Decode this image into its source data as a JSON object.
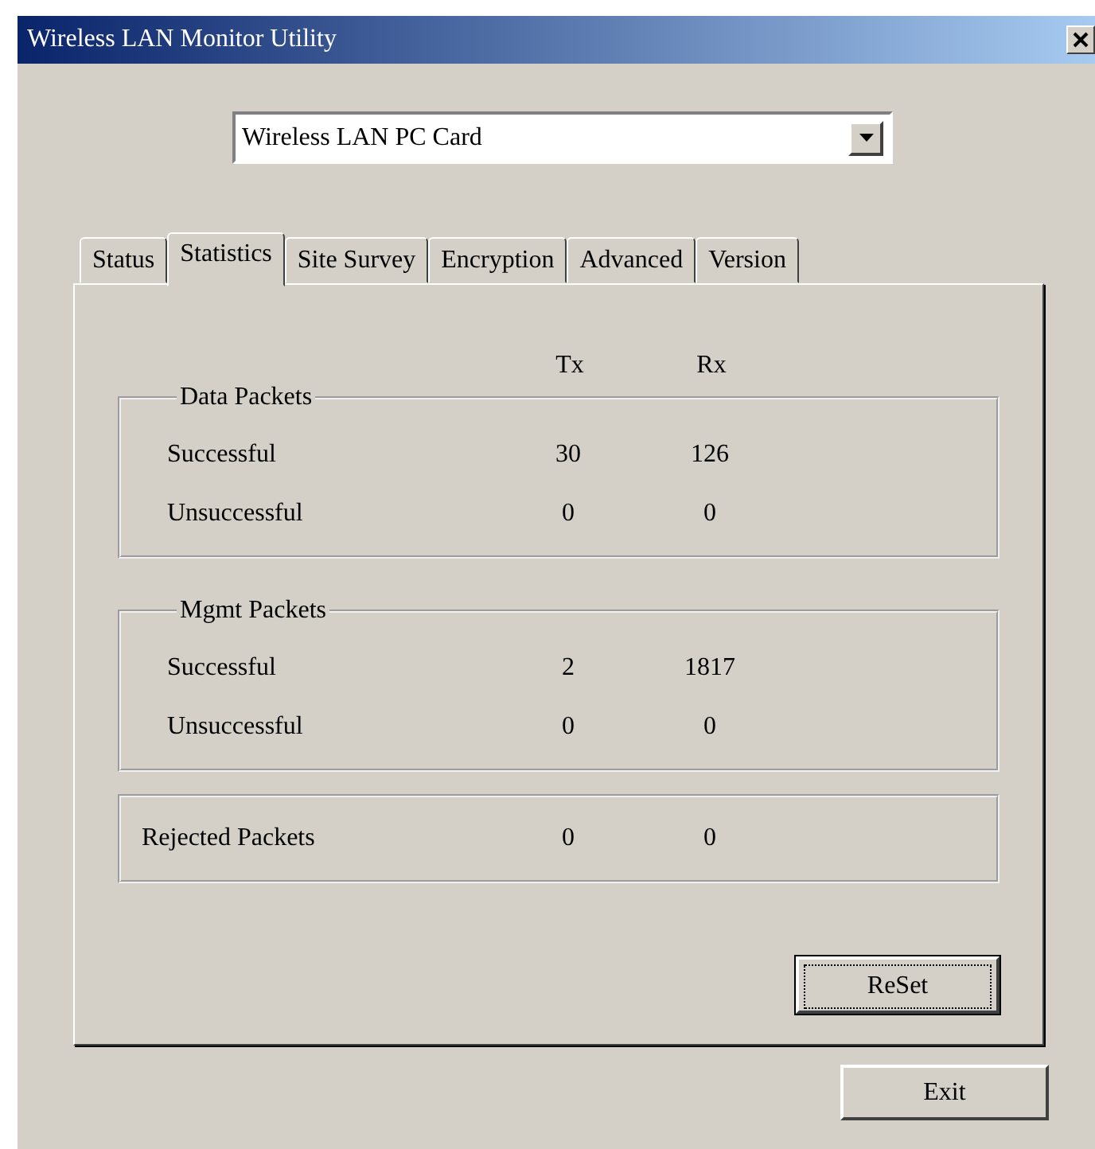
{
  "window": {
    "title": "Wireless LAN Monitor Utility"
  },
  "device_select": {
    "value": "Wireless LAN PC Card"
  },
  "tabs": [
    {
      "label": "Status",
      "selected": false
    },
    {
      "label": "Statistics",
      "selected": true
    },
    {
      "label": "Site Survey",
      "selected": false
    },
    {
      "label": "Encryption",
      "selected": false
    },
    {
      "label": "Advanced",
      "selected": false
    },
    {
      "label": "Version",
      "selected": false
    }
  ],
  "columns": [
    "Tx",
    "Rx"
  ],
  "groups": [
    {
      "kind": "titled",
      "title": "Data Packets",
      "rows": [
        {
          "label": "Successful",
          "tx": "30",
          "rx": "126"
        },
        {
          "label": "Unsuccessful",
          "tx": "0",
          "rx": "0"
        }
      ]
    },
    {
      "kind": "titled",
      "title": "Mgmt Packets",
      "rows": [
        {
          "label": "Successful",
          "tx": "2",
          "rx": "1817"
        },
        {
          "label": "Unsuccessful",
          "tx": "0",
          "rx": "0"
        }
      ]
    },
    {
      "kind": "plain",
      "rows": [
        {
          "label": "Rejected Packets",
          "tx": "0",
          "rx": "0"
        }
      ]
    }
  ],
  "reset_button": {
    "label": "ReSet",
    "focused": true
  },
  "exit_button": {
    "label": "Exit"
  }
}
